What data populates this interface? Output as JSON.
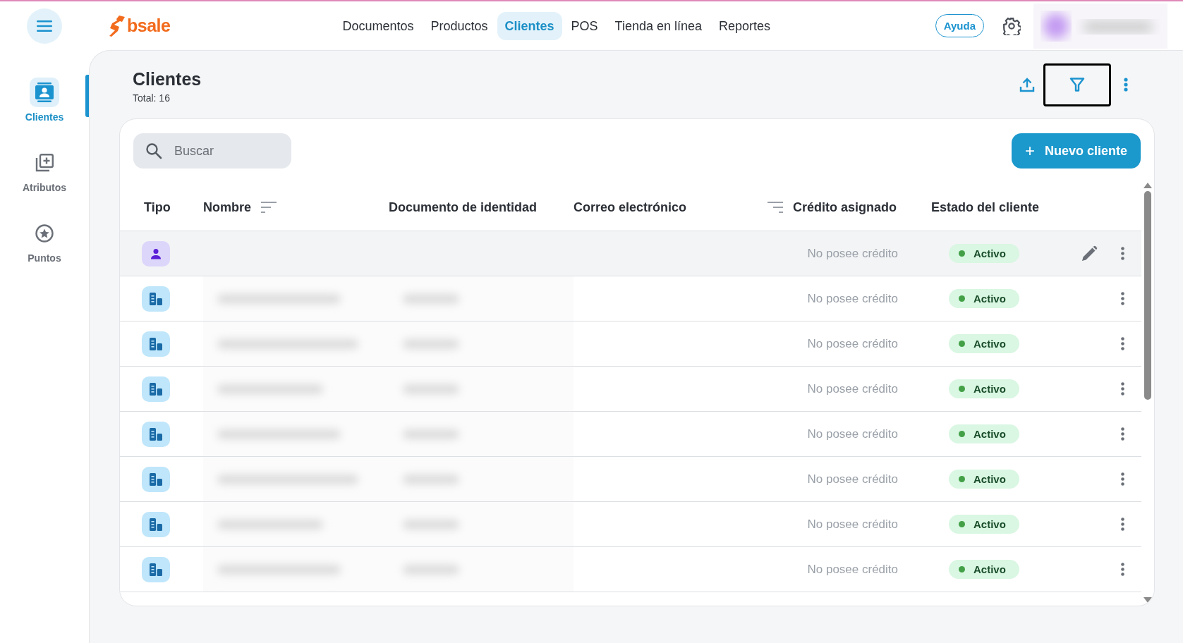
{
  "topbar": {
    "logo": "bsale",
    "nav": [
      {
        "label": "Documentos",
        "selected": false
      },
      {
        "label": "Productos",
        "selected": false
      },
      {
        "label": "Clientes",
        "selected": true
      },
      {
        "label": "POS",
        "selected": false
      },
      {
        "label": "Tienda en línea",
        "selected": false
      },
      {
        "label": "Reportes",
        "selected": false
      }
    ],
    "help_button": "Ayuda"
  },
  "sidebar": {
    "items": [
      {
        "label": "Clientes",
        "kind": "contacts",
        "selected": true
      },
      {
        "label": "Atributos",
        "kind": "attributes",
        "selected": false
      },
      {
        "label": "Puntos",
        "kind": "points",
        "selected": false
      }
    ]
  },
  "page": {
    "title": "Clientes",
    "total": "Total: 16",
    "filter_focused": true
  },
  "search": {
    "placeholder": "Buscar"
  },
  "new_button": {
    "icon": "+",
    "label": "Nuevo cliente"
  },
  "table": {
    "columns": [
      {
        "label": "Tipo"
      },
      {
        "label": "Nombre",
        "kind": "sorted"
      },
      {
        "label": "Documento de identidad"
      },
      {
        "label": "Correo electrónico"
      },
      {
        "label": "Crédito asignado",
        "kind": "filtered"
      },
      {
        "label": "Estado del cliente"
      }
    ],
    "rows": [
      {
        "kind": "person",
        "redacted": false,
        "hovered": true,
        "credit": "No posee crédito",
        "status": "Activo",
        "active": true
      },
      {
        "kind": "company",
        "redacted": true,
        "hovered": false,
        "credit": "No posee crédito",
        "status": "Activo",
        "active": true
      },
      {
        "kind": "company",
        "redacted": true,
        "hovered": false,
        "credit": "No posee crédito",
        "status": "Activo",
        "active": true
      },
      {
        "kind": "company",
        "redacted": true,
        "hovered": false,
        "credit": "No posee crédito",
        "status": "Activo",
        "active": true
      },
      {
        "kind": "company",
        "redacted": true,
        "hovered": false,
        "credit": "No posee crédito",
        "status": "Activo",
        "active": true
      },
      {
        "kind": "company",
        "redacted": true,
        "hovered": false,
        "credit": "No posee crédito",
        "status": "Activo",
        "active": true
      },
      {
        "kind": "company",
        "redacted": true,
        "hovered": false,
        "credit": "No posee crédito",
        "status": "Activo",
        "active": true
      },
      {
        "kind": "company",
        "redacted": true,
        "hovered": false,
        "credit": "No posee crédito",
        "status": "Activo",
        "active": true
      }
    ]
  }
}
